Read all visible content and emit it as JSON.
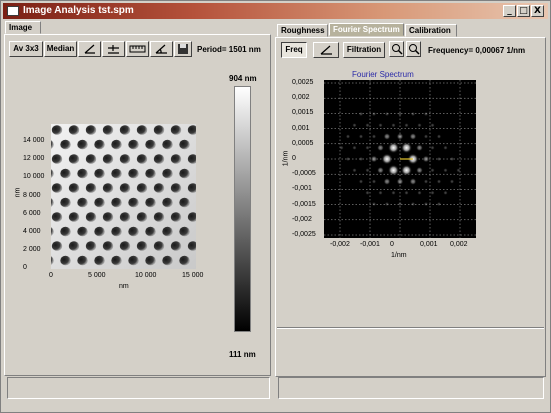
{
  "window": {
    "title": "Image Analysis tst.spm",
    "controls": {
      "minimize": "_",
      "maximize": "□",
      "close": "X"
    }
  },
  "left_panel": {
    "tab": "Image",
    "toolbar": {
      "av": "Av 3x3",
      "median": "Median",
      "icons": [
        "angle-icon",
        "level-icon",
        "ruler-icon",
        "angle-measure-icon",
        "save-icon"
      ],
      "period_label": "Period= 1501 nm"
    },
    "image": {
      "y_ticks": [
        "14 000",
        "12 000",
        "10 000",
        "8 000",
        "6 000",
        "4 000",
        "2 000",
        "0"
      ],
      "x_ticks": [
        "0",
        "5 000",
        "10 000",
        "15 000"
      ],
      "x_unit": "nm",
      "y_unit": "nm",
      "scale_max": "904 nm",
      "scale_min": "111 nm"
    }
  },
  "right_panel": {
    "tabs": [
      "Roughness",
      "Fourier Spectrum",
      "Calibration"
    ],
    "active_tab": "Fourier Spectrum",
    "toolbar": {
      "freq": "Freq",
      "filtration": "Filtration",
      "frequency_label": "Frequency= 0,00067 1/nm"
    },
    "plot": {
      "title": "Fourier Spectrum",
      "y_ticks": [
        "0,0025",
        "0,002",
        "0,0015",
        "0,001",
        "0,0005",
        "0",
        "-0,0005",
        "-0,001",
        "-0,0015",
        "-0,002",
        "-0,0025"
      ],
      "x_ticks": [
        "-0,002",
        "-0,001",
        "0",
        "0,001",
        "0,002"
      ],
      "x_unit": "1/nm",
      "y_unit": "1/nm"
    }
  }
}
